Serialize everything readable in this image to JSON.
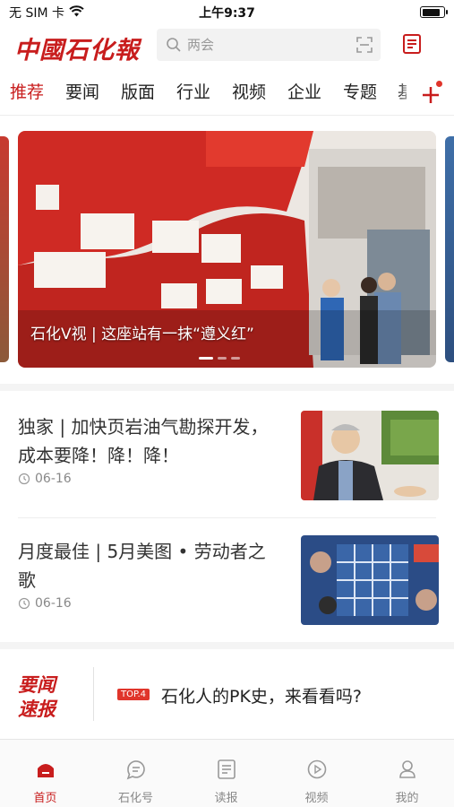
{
  "status_bar": {
    "carrier": "无 SIM 卡",
    "time": "上午9:37",
    "battery_level": 0.9
  },
  "header": {
    "logo_text": "中國石化報",
    "search_placeholder": "两会",
    "icons": [
      "search-icon",
      "scan-icon",
      "newspaper-icon"
    ]
  },
  "tabs": [
    {
      "label": "推荐",
      "active": true
    },
    {
      "label": "要闻",
      "active": false
    },
    {
      "label": "版面",
      "active": false
    },
    {
      "label": "行业",
      "active": false
    },
    {
      "label": "视频",
      "active": false
    },
    {
      "label": "企业",
      "active": false
    },
    {
      "label": "专题",
      "active": false
    },
    {
      "label": "基",
      "active": false
    }
  ],
  "banner": {
    "caption": "石化V视 | 这座站有一抹“遵义红”",
    "slide_count": 3,
    "current_slide": 1
  },
  "news": [
    {
      "title": "独家 | 加快页岩油气勘探开发，成本要降！降！降！",
      "date": "06-16"
    },
    {
      "title": "月度最佳 | 5月美图 • 劳动者之歌",
      "date": "06-16"
    }
  ],
  "quick_news": {
    "logo_line1": "要闻",
    "logo_line2": "速报",
    "badge": "TOP.4",
    "headline": "石化人的PK史，来看看吗?"
  },
  "bottom_tabs": [
    {
      "label": "首页",
      "icon": "home-icon",
      "active": true
    },
    {
      "label": "石化号",
      "icon": "chat-icon",
      "active": false
    },
    {
      "label": "读报",
      "icon": "newspaper-icon",
      "active": false
    },
    {
      "label": "视频",
      "icon": "play-icon",
      "active": false
    },
    {
      "label": "我的",
      "icon": "user-icon",
      "active": false
    }
  ],
  "colors": {
    "brand_red": "#c81d1d",
    "badge_red": "#e0352b",
    "muted_text": "#888888"
  }
}
